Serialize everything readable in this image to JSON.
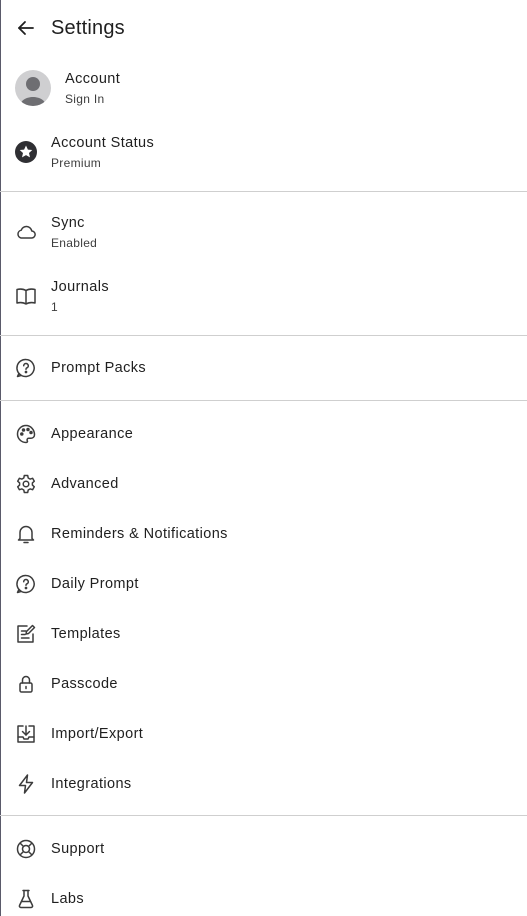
{
  "header": {
    "title": "Settings"
  },
  "account": {
    "label": "Account",
    "sub": "Sign In"
  },
  "account_status": {
    "label": "Account Status",
    "sub": "Premium"
  },
  "sync": {
    "label": "Sync",
    "sub": "Enabled"
  },
  "journals": {
    "label": "Journals",
    "sub": "1"
  },
  "prompt_packs": {
    "label": "Prompt Packs"
  },
  "items": [
    {
      "label": "Appearance",
      "icon": "palette-icon"
    },
    {
      "label": "Advanced",
      "icon": "gear-icon"
    },
    {
      "label": "Reminders & Notifications",
      "icon": "bell-icon"
    },
    {
      "label": "Daily Prompt",
      "icon": "question-bubble-icon"
    },
    {
      "label": "Templates",
      "icon": "template-edit-icon"
    },
    {
      "label": "Passcode",
      "icon": "lock-icon"
    },
    {
      "label": "Import/Export",
      "icon": "download-tray-icon"
    },
    {
      "label": "Integrations",
      "icon": "lightning-icon"
    }
  ],
  "support": {
    "label": "Support"
  },
  "labs": {
    "label": "Labs"
  },
  "colors": {
    "icon": "#3c3c3c",
    "divider": "#cfcfcf",
    "text": "#1f1f1f"
  }
}
